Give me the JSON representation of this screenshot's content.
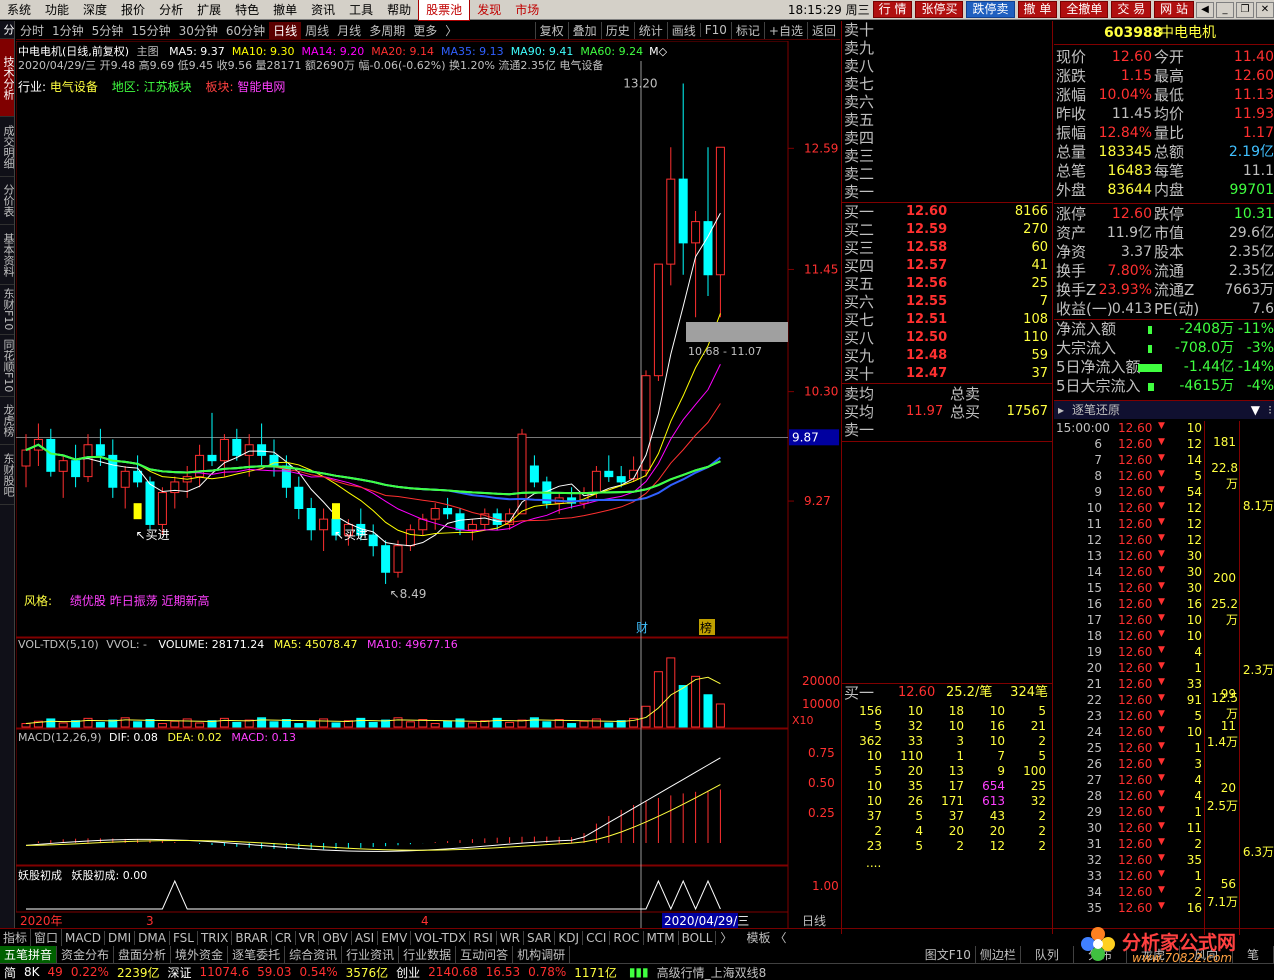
{
  "menu": {
    "items": [
      "系统",
      "功能",
      "深度",
      "报价",
      "分析",
      "扩展",
      "特色",
      "撤单",
      "资讯",
      "工具",
      "帮助"
    ],
    "highlight": [
      "股票池",
      "发现",
      "市场"
    ],
    "clock": "18:15:29 周三",
    "actions": [
      "行 情",
      "张停买",
      "跌停卖",
      "撤 单",
      "全撤单",
      "交 易",
      "网 站"
    ]
  },
  "left_tabs": [
    "技术分析",
    "成交明细",
    "分价表",
    "基本资料",
    "东财F10",
    "同花顺F10",
    "龙虎榜",
    "东财股吧"
  ],
  "periods": [
    "分时",
    "1分钟",
    "5分钟",
    "15分钟",
    "30分钟",
    "60分钟",
    "日线",
    "周线",
    "月线",
    "多周期",
    "更多"
  ],
  "period_active": "日线",
  "toolbar": [
    "复权",
    "叠加",
    "历史",
    "统计",
    "画线",
    "F10",
    "标记",
    "+自选",
    "返回"
  ],
  "chart": {
    "title_stock": "中电电机(日线,前复权)",
    "main_label": "主图",
    "ma": [
      {
        "label": "MA5: 9.37",
        "color": "#ffffff"
      },
      {
        "label": "MA10: 9.30",
        "color": "#ffff00"
      },
      {
        "label": "MA14: 9.20",
        "color": "#ff00ff"
      },
      {
        "label": "MA20: 9.14",
        "color": "#ff3030"
      },
      {
        "label": "MA35: 9.13",
        "color": "#3060ff"
      },
      {
        "label": "MA90: 9.41",
        "color": "#40ffff"
      },
      {
        "label": "MA60: 9.24",
        "color": "#40ff40"
      }
    ],
    "ohlc_line": "2020/04/29/三 开9.48 高9.69 低9.45 收9.56 量28171 额2690万 幅-0.06(-0.62%) 换1.20% 流通2.35亿 电气设备",
    "industry_label": "行业:",
    "industry": "电气设备",
    "region_label": "地区:",
    "region": "江苏板块",
    "sector_label": "板块:",
    "sector": "智能电网",
    "style_label": "风格:",
    "style": "绩优股 昨日振荡 近期新高",
    "price_axis": [
      "12.59",
      "11.45",
      "10.30",
      "9.27"
    ],
    "cursor_price": "9.87",
    "high_label": "13.20",
    "low_label": "8.49",
    "range_label": "10.68 - 11.07",
    "buy_label_1": "买进",
    "buy_label_2": "买进",
    "marker_cai": "财",
    "marker_bang": "榜",
    "candles": [
      [
        9.6,
        9.9,
        9.4,
        9.75
      ],
      [
        9.75,
        10.0,
        9.6,
        9.85
      ],
      [
        9.85,
        9.95,
        9.5,
        9.55
      ],
      [
        9.55,
        9.7,
        9.3,
        9.65
      ],
      [
        9.65,
        9.8,
        9.4,
        9.5
      ],
      [
        9.5,
        9.9,
        9.45,
        9.8
      ],
      [
        9.8,
        9.95,
        9.6,
        9.7
      ],
      [
        9.7,
        9.85,
        9.3,
        9.4
      ],
      [
        9.4,
        9.6,
        9.2,
        9.55
      ],
      [
        9.55,
        9.7,
        9.4,
        9.45
      ],
      [
        9.45,
        9.5,
        9.0,
        9.05
      ],
      [
        9.05,
        9.4,
        8.95,
        9.35
      ],
      [
        9.35,
        9.5,
        9.2,
        9.45
      ],
      [
        9.45,
        9.6,
        9.3,
        9.5
      ],
      [
        9.5,
        9.8,
        9.4,
        9.7
      ],
      [
        9.7,
        10.1,
        9.6,
        9.65
      ],
      [
        9.65,
        9.9,
        9.5,
        9.85
      ],
      [
        9.85,
        9.95,
        9.65,
        9.7
      ],
      [
        9.7,
        9.9,
        9.5,
        9.8
      ],
      [
        9.8,
        10.0,
        9.6,
        9.7
      ],
      [
        9.7,
        9.85,
        9.5,
        9.6
      ],
      [
        9.6,
        9.7,
        9.3,
        9.4
      ],
      [
        9.4,
        9.5,
        9.1,
        9.2
      ],
      [
        9.2,
        9.3,
        8.9,
        9.0
      ],
      [
        9.0,
        9.2,
        8.8,
        9.1
      ],
      [
        9.1,
        9.2,
        8.9,
        8.95
      ],
      [
        8.95,
        9.1,
        8.85,
        9.05
      ],
      [
        9.05,
        9.2,
        8.9,
        8.95
      ],
      [
        8.95,
        9.05,
        8.75,
        8.85
      ],
      [
        8.85,
        8.9,
        8.49,
        8.6
      ],
      [
        8.6,
        8.9,
        8.55,
        8.85
      ],
      [
        8.85,
        9.05,
        8.8,
        9.0
      ],
      [
        9.0,
        9.15,
        8.95,
        9.1
      ],
      [
        9.1,
        9.25,
        9.0,
        9.2
      ],
      [
        9.2,
        9.3,
        9.1,
        9.15
      ],
      [
        9.15,
        9.2,
        8.95,
        9.0
      ],
      [
        9.0,
        9.1,
        8.9,
        9.05
      ],
      [
        9.05,
        9.2,
        9.0,
        9.15
      ],
      [
        9.15,
        9.2,
        9.0,
        9.05
      ],
      [
        9.05,
        9.2,
        9.0,
        9.15
      ],
      [
        9.15,
        9.95,
        9.6,
        9.9
      ],
      [
        9.6,
        9.7,
        9.4,
        9.45
      ],
      [
        9.45,
        9.5,
        9.2,
        9.25
      ],
      [
        9.25,
        9.35,
        9.15,
        9.3
      ],
      [
        9.3,
        9.4,
        9.2,
        9.25
      ],
      [
        9.25,
        9.4,
        9.2,
        9.35
      ],
      [
        9.35,
        9.6,
        9.3,
        9.55
      ],
      [
        9.55,
        9.7,
        9.45,
        9.5
      ],
      [
        9.5,
        9.6,
        9.4,
        9.45
      ],
      [
        9.48,
        9.69,
        9.45,
        9.56
      ],
      [
        9.56,
        10.5,
        9.5,
        10.45
      ],
      [
        10.45,
        11.5,
        10.4,
        11.5
      ],
      [
        11.5,
        12.6,
        11.3,
        12.3
      ],
      [
        12.3,
        13.2,
        11.4,
        11.7
      ],
      [
        11.7,
        12.0,
        11.0,
        11.9
      ],
      [
        11.9,
        12.6,
        11.2,
        11.4
      ],
      [
        11.4,
        12.6,
        11.0,
        12.6
      ]
    ]
  },
  "vol_panel": {
    "label": "VOL-TDX(5,10)",
    "vvol": "VVOL: -",
    "volume": "VOLUME: 28171.24",
    "ma5": "MA5: 45078.47",
    "ma10": "MA10: 49677.16",
    "axis": [
      "20000",
      "10000"
    ],
    "unit": "X10"
  },
  "macd_panel": {
    "label": "MACD(12,26,9)",
    "dif": "DIF: 0.08",
    "dea": "DEA: 0.02",
    "macd": "MACD: 0.13",
    "axis": [
      "0.75",
      "0.50",
      "0.25"
    ]
  },
  "yao_panel": {
    "label": "妖股初成",
    "value": "妖股初成: 0.00",
    "axis": "1.00"
  },
  "x_axis": {
    "y2020": "2020年",
    "m3": "3",
    "m4": "4",
    "cursor_date": "2020/04/29/三",
    "period": "日线"
  },
  "indicator_tabs": [
    "指标",
    "窗口",
    "MACD",
    "DMI",
    "DMA",
    "FSL",
    "TRIX",
    "BRAR",
    "CR",
    "VR",
    "OBV",
    "ASI",
    "EMV",
    "VOL-TDX",
    "RSI",
    "WR",
    "SAR",
    "KDJ",
    "CCI",
    "ROC",
    "MTM",
    "BOLL"
  ],
  "mode_label": "模板",
  "sell_levels": [
    "卖十",
    "卖九",
    "卖八",
    "卖七",
    "卖六",
    "卖五",
    "卖四",
    "卖三",
    "卖二",
    "卖一"
  ],
  "buy_levels": [
    {
      "label": "买一",
      "price": "12.60",
      "vol": "8166"
    },
    {
      "label": "买二",
      "price": "12.59",
      "vol": "270"
    },
    {
      "label": "买三",
      "price": "12.58",
      "vol": "60"
    },
    {
      "label": "买四",
      "price": "12.57",
      "vol": "41"
    },
    {
      "label": "买五",
      "price": "12.56",
      "vol": "25"
    },
    {
      "label": "买六",
      "price": "12.55",
      "vol": "7"
    },
    {
      "label": "买七",
      "price": "12.51",
      "vol": "108"
    },
    {
      "label": "买八",
      "price": "12.50",
      "vol": "110"
    },
    {
      "label": "买九",
      "price": "12.48",
      "vol": "59"
    },
    {
      "label": "买十",
      "price": "12.47",
      "vol": "37"
    }
  ],
  "ob_summary": {
    "sell_avg": "卖均",
    "total_sell": "总卖",
    "buy_avg": "买均",
    "buy_avg_val": "11.97",
    "total_buy": "总买",
    "total_buy_val": "17567",
    "sell_one": "卖一"
  },
  "queue_head": {
    "label": "买一",
    "price": "12.60",
    "count": "25.2/笔",
    "total": "324笔"
  },
  "queue": [
    [
      "156",
      "10",
      "18",
      "10",
      "5"
    ],
    [
      "5",
      "32",
      "10",
      "16",
      "21"
    ],
    [
      "362",
      "33",
      "3",
      "10",
      "2"
    ],
    [
      "10",
      "110",
      "1",
      "7",
      "5"
    ],
    [
      "5",
      "20",
      "13",
      "9",
      "100"
    ],
    [
      "10",
      "35",
      "17",
      "654",
      "25"
    ],
    [
      "10",
      "26",
      "171",
      "613",
      "32"
    ],
    [
      "37",
      "5",
      "37",
      "43",
      "2"
    ],
    [
      "2",
      "4",
      "20",
      "20",
      "2"
    ],
    [
      "23",
      "5",
      "2",
      "12",
      "2"
    ]
  ],
  "queue_more": "....",
  "quote": {
    "code": "603988",
    "name": "中电电机",
    "rows": [
      [
        "现价",
        "12.60",
        "今开",
        "11.40"
      ],
      [
        "涨跌",
        "1.15",
        "最高",
        "12.60"
      ],
      [
        "涨幅",
        "10.04%",
        "最低",
        "11.13"
      ],
      [
        "昨收",
        "11.45",
        "均价",
        "11.93"
      ],
      [
        "振幅",
        "12.84%",
        "量比",
        "1.17"
      ],
      [
        "总量",
        "183345",
        "总额",
        "2.19亿"
      ],
      [
        "总笔",
        "16483",
        "每笔",
        "11.1"
      ],
      [
        "外盘",
        "83644",
        "内盘",
        "99701"
      ]
    ],
    "rows2": [
      [
        "涨停",
        "12.60",
        "跌停",
        "10.31"
      ],
      [
        "资产",
        "11.9亿",
        "市值",
        "29.6亿"
      ],
      [
        "净资",
        "3.37",
        "股本",
        "2.35亿"
      ],
      [
        "换手",
        "7.80%",
        "流通",
        "2.35亿"
      ],
      [
        "换手Z",
        "23.93%",
        "流通Z",
        "7663万"
      ],
      [
        "收益(一)",
        "0.413",
        "PE(动)",
        "7.6"
      ]
    ],
    "flows": [
      [
        "净流入额",
        "-2408万",
        "-11%"
      ],
      [
        "大宗流入",
        "-708.0万",
        "-3%"
      ],
      [
        "5日净流入额",
        "-1.44亿",
        "-14%"
      ],
      [
        "5日大宗流入",
        "-4615万",
        "-4%"
      ]
    ]
  },
  "tick_title": "逐笔还原",
  "ticks": [
    [
      "15:00:00",
      "12.60",
      "10"
    ],
    [
      "6",
      "12.60",
      "12"
    ],
    [
      "7",
      "12.60",
      "14"
    ],
    [
      "8",
      "12.60",
      "5"
    ],
    [
      "9",
      "12.60",
      "54"
    ],
    [
      "10",
      "12.60",
      "12"
    ],
    [
      "11",
      "12.60",
      "12"
    ],
    [
      "12",
      "12.60",
      "12"
    ],
    [
      "13",
      "12.60",
      "30"
    ],
    [
      "14",
      "12.60",
      "30"
    ],
    [
      "15",
      "12.60",
      "30"
    ],
    [
      "16",
      "12.60",
      "16"
    ],
    [
      "17",
      "12.60",
      "10"
    ],
    [
      "18",
      "12.60",
      "10"
    ],
    [
      "19",
      "12.60",
      "4"
    ],
    [
      "20",
      "12.60",
      "1"
    ],
    [
      "21",
      "12.60",
      "33"
    ],
    [
      "22",
      "12.60",
      "91"
    ],
    [
      "23",
      "12.60",
      "5"
    ],
    [
      "24",
      "12.60",
      "10"
    ],
    [
      "25",
      "12.60",
      "1"
    ],
    [
      "26",
      "12.60",
      "3"
    ],
    [
      "27",
      "12.60",
      "4"
    ],
    [
      "28",
      "12.60",
      "4"
    ],
    [
      "29",
      "12.60",
      "1"
    ],
    [
      "30",
      "12.60",
      "11"
    ],
    [
      "31",
      "12.60",
      "2"
    ],
    [
      "32",
      "12.60",
      "35"
    ],
    [
      "33",
      "12.60",
      "1"
    ],
    [
      "34",
      "12.60",
      "2"
    ],
    [
      "35",
      "12.60",
      "16"
    ]
  ],
  "tick_groups": [
    [
      "181",
      "22.8万"
    ],
    [
      "200",
      "25.2万"
    ],
    [
      "99",
      "12.5万"
    ],
    [
      "11",
      "1.4万"
    ],
    [
      "20",
      "2.5万"
    ],
    [
      "56",
      "7.1万"
    ]
  ],
  "tick_right": [
    [
      "8.1万"
    ],
    [
      "2.3万"
    ],
    [
      "6.3万"
    ]
  ],
  "bottom_tabs": [
    "五笔拼音",
    "资金分布",
    "盘面分析",
    "境外资金",
    "逐笔委托",
    "综合资讯",
    "行业资讯",
    "行业数据",
    "互动问答",
    "机构调研"
  ],
  "right_tabs": [
    "图文F10",
    "侧边栏",
    "队列",
    "分布",
    "龙虎",
    "风向",
    "笔"
  ],
  "status": {
    "s1_label": "简",
    "s1_code": "8K",
    "s1_val": "49",
    "s1_pct": "0.22%",
    "s1_amt": "2239亿",
    "s2_label": "深证",
    "s2_val": "11074.6",
    "s2_chg": "59.03",
    "s2_pct": "0.54%",
    "s2_amt": "3576亿",
    "s3_label": "创业",
    "s3_val": "2140.68",
    "s3_chg": "16.53",
    "s3_pct": "0.78%",
    "s3_amt": "1171亿",
    "feed": "高级行情_上海双线8"
  },
  "watermark": {
    "title": "分析家公式网",
    "url": "www.70822.com"
  },
  "colors": {
    "up": "#ff3030",
    "down": "#00ffff",
    "bg": "#000000",
    "border": "#800000",
    "vol": "#ffff40"
  }
}
